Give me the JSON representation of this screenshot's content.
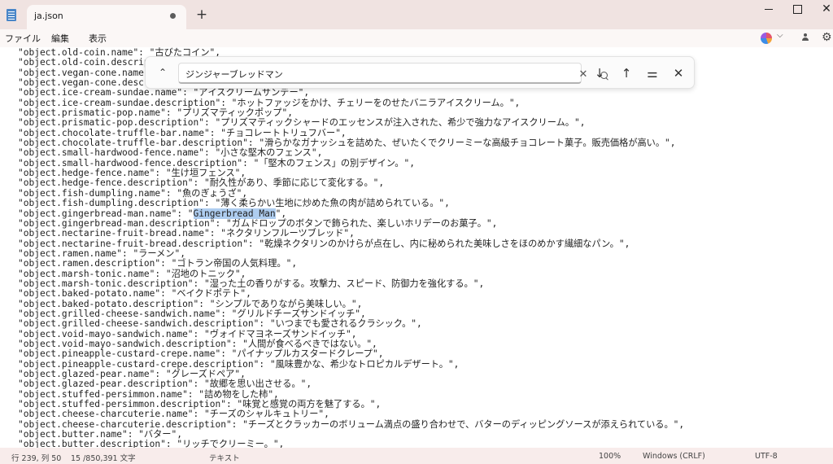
{
  "window": {
    "tab_title": "ja.json",
    "new_tab": "+",
    "close_glyph": "✕"
  },
  "menu": {
    "file": "ファイル",
    "edit": "編集",
    "view": "表示",
    "dropdown_glyph": "⌵",
    "settings_glyph": "⚙"
  },
  "find": {
    "query": "ジンジャーブレッドマン",
    "collapse_glyph": "⌃",
    "clear_glyph": "✕",
    "next_glyph": "↓",
    "prev_glyph": "↑",
    "options_glyph": "⚌",
    "close_glyph": "✕"
  },
  "editor": {
    "lines": [
      {
        "text": "\"object.old-coin.name\": \"古びたコイン\","
      },
      {
        "text": "\"object.old-coin.descrip"
      },
      {
        "text": "\"object.vegan-cone.name\""
      },
      {
        "text": "\"object.vegan-cone.descr"
      },
      {
        "text": "\"object.ice-cream-sundae.name\": \"アイスクリームサンデー\","
      },
      {
        "text": "\"object.ice-cream-sundae.description\": \"ホットファッジをかけ、チェリーをのせたバニラアイスクリーム。\","
      },
      {
        "text": "\"object.prismatic-pop.name\": \"プリズマティックポップ\","
      },
      {
        "text": "\"object.prismatic-pop.description\": \"プリズマティックシャードのエッセンスが注入された、希少で強力なアイスクリーム。\","
      },
      {
        "text": "\"object.chocolate-truffle-bar.name\": \"チョコレートトリュフバー\","
      },
      {
        "text": "\"object.chocolate-truffle-bar.description\": \"滑らかなガナッシュを詰めた、ぜいたくでクリーミーな高級チョコレート菓子。販売価格が高い。\","
      },
      {
        "text": "\"object.small-hardwood-fence.name\": \"小さな堅木のフェンス\","
      },
      {
        "text": "\"object.small-hardwood-fence.description\": \"「堅木のフェンス」の別デザイン。\","
      },
      {
        "text": "\"object.hedge-fence.name\": \"生け垣フェンス\","
      },
      {
        "text": "\"object.hedge-fence.description\": \"耐久性があり、季節に応じて変化する。\","
      },
      {
        "text": "\"object.fish-dumpling.name\": \"魚のぎょうざ\","
      },
      {
        "text": "\"object.fish-dumpling.description\": \"薄く柔らかい生地に炒めた魚の肉が詰められている。\","
      },
      {
        "pre": "\"object.gingerbread-man.name\": \"",
        "match": "Gingerbread Man",
        "post": "\","
      },
      {
        "text": "\"object.gingerbread-man.description\": \"ガムドロップのボタンで飾られた、楽しいホリデーのお菓子。\","
      },
      {
        "text": "\"object.nectarine-fruit-bread.name\": \"ネクタリンフルーツブレッド\","
      },
      {
        "text": "\"object.nectarine-fruit-bread.description\": \"乾燥ネクタリンのかけらが点在し、内に秘められた美味しさをほのめかす繊細なパン。\","
      },
      {
        "text": "\"object.ramen.name\": \"ラーメン\","
      },
      {
        "text": "\"object.ramen.description\": \"ゴトラン帝国の人気料理。\","
      },
      {
        "text": "\"object.marsh-tonic.name\": \"沼地のトニック\","
      },
      {
        "text": "\"object.marsh-tonic.description\": \"湿った土の香りがする。攻撃力、スピード、防御力を強化する。\","
      },
      {
        "text": "\"object.baked-potato.name\": \"ベイクドポテト\","
      },
      {
        "text": "\"object.baked-potato.description\": \"シンプルでありながら美味しい。\","
      },
      {
        "text": "\"object.grilled-cheese-sandwich.name\": \"グリルドチーズサンドイッチ\","
      },
      {
        "text": "\"object.grilled-cheese-sandwich.description\": \"いつまでも愛されるクラシック。\","
      },
      {
        "text": "\"object.void-mayo-sandwich.name\": \"ヴォイドマヨネーズサンドイッチ\","
      },
      {
        "text": "\"object.void-mayo-sandwich.description\": \"人間が食べるべきではない。\","
      },
      {
        "text": "\"object.pineapple-custard-crepe.name\": \"パイナップルカスタードクレープ\","
      },
      {
        "text": "\"object.pineapple-custard-crepe.description\": \"風味豊かな、希少なトロピカルデザート。\","
      },
      {
        "text": "\"object.glazed-pear.name\": \"グレーズドペア\","
      },
      {
        "text": "\"object.glazed-pear.description\": \"故郷を思い出させる。\","
      },
      {
        "text": "\"object.stuffed-persimmon.name\": \"詰め物をした柿\","
      },
      {
        "text": "\"object.stuffed-persimmon.description\": \"味覚と感覚の両方を魅了する。\","
      },
      {
        "text": "\"object.cheese-charcuterie.name\": \"チーズのシャルキュトリー\","
      },
      {
        "text": "\"object.cheese-charcuterie.description\": \"チーズとクラッカーのボリューム満点の盛り合わせで、バターのディッピングソースが添えられている。\","
      },
      {
        "text": "\"object.butter.name\": \"バター\","
      },
      {
        "text": "\"object.butter.description\": \"リッチでクリーミー。\","
      }
    ]
  },
  "status": {
    "position": "行 239, 列 50",
    "chars": "15 /850,391 文字",
    "mode": "テキスト",
    "zoom": "100%",
    "line_ending": "Windows (CRLF)",
    "encoding": "UTF-8"
  }
}
